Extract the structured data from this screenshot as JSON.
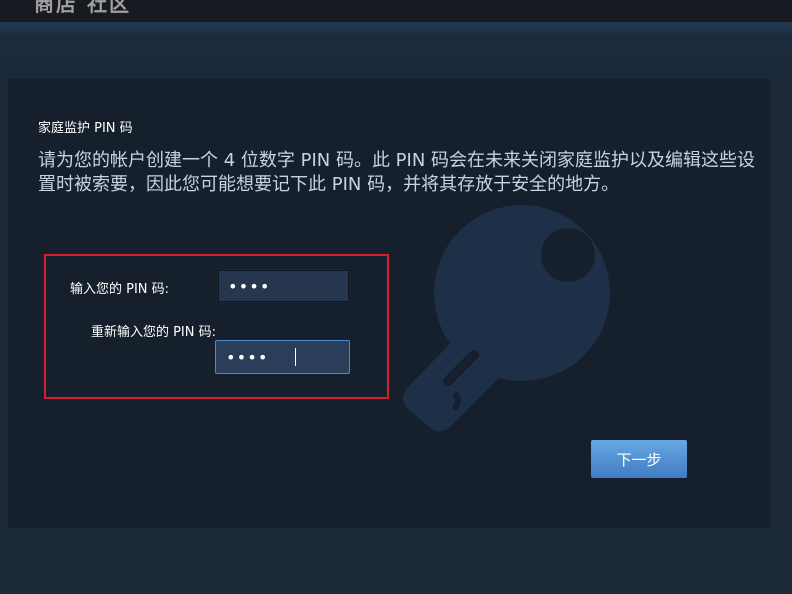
{
  "header": {
    "partial_title": "商店  社区"
  },
  "dialog": {
    "heading": "家庭监护 PIN 码",
    "description": "请为您的帐户创建一个 4 位数字 PIN 码。此 PIN 码会在未来关闭家庭监护以及编辑这些设置时被索要，因此您可能想要记下此 PIN 码，并将其存放于安全的地方。",
    "pin_label": "输入您的 PIN 码:",
    "pin_value": "••••",
    "repin_label": "重新输入您的 PIN 码:",
    "repin_value": "••••",
    "next_label": "下一步"
  },
  "icons": {
    "watermark": "key-icon"
  },
  "colors": {
    "background": "#1b2838",
    "panel": "#16202d",
    "highlight_border": "#d3202e",
    "button": "#417cc2"
  }
}
